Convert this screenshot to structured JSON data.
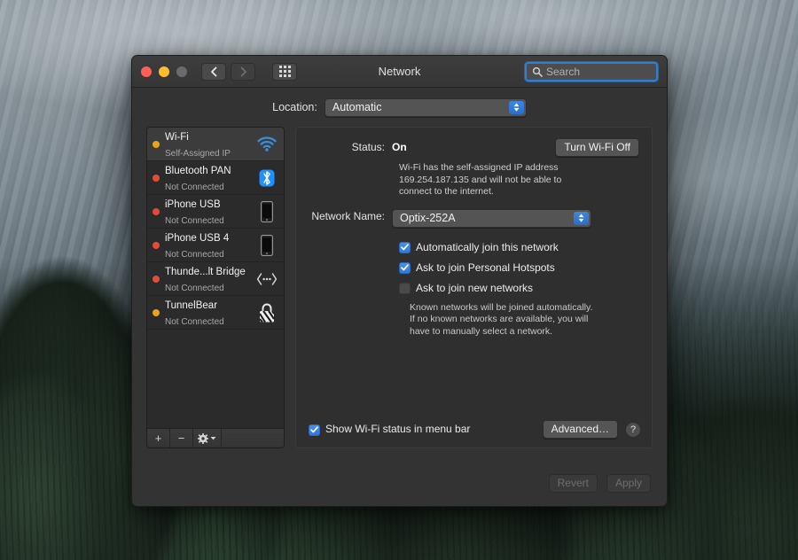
{
  "window": {
    "title": "Network",
    "traffic_lights": [
      "close",
      "minimize",
      "zoom"
    ],
    "nav": {
      "back": "back-chevron",
      "forward": "forward-chevron",
      "grid": "show-all-grid"
    },
    "search": {
      "placeholder": "Search",
      "value": "",
      "icon": "search-icon"
    }
  },
  "location": {
    "label": "Location:",
    "value": "Automatic"
  },
  "sidebar": {
    "services": [
      {
        "name": "Wi-Fi",
        "status": "Self-Assigned IP",
        "dot": "amber",
        "icon": "wifi-icon",
        "selected": true
      },
      {
        "name": "Bluetooth PAN",
        "status": "Not Connected",
        "dot": "red",
        "icon": "bluetooth-icon",
        "selected": false
      },
      {
        "name": "iPhone USB",
        "status": "Not Connected",
        "dot": "red",
        "icon": "iphone-icon",
        "selected": false
      },
      {
        "name": "iPhone USB 4",
        "status": "Not Connected",
        "dot": "red",
        "icon": "iphone-icon",
        "selected": false
      },
      {
        "name": "Thunde...lt Bridge",
        "status": "Not Connected",
        "dot": "red",
        "icon": "thunderbolt-icon",
        "selected": false
      },
      {
        "name": "TunnelBear",
        "status": "Not Connected",
        "dot": "amber",
        "icon": "lock-icon",
        "selected": false
      }
    ],
    "toolbar": {
      "add": "+",
      "remove": "−",
      "actions": "gear-icon"
    }
  },
  "detail": {
    "status_label": "Status:",
    "status_value": "On",
    "turn_off_button": "Turn Wi-Fi Off",
    "status_description": "Wi-Fi has the self-assigned IP address 169.254.187.135 and will not be able to connect to the internet.",
    "network_name_label": "Network Name:",
    "network_name_value": "Optix-252A",
    "checkboxes": [
      {
        "label": "Automatically join this network",
        "checked": true
      },
      {
        "label": "Ask to join Personal Hotspots",
        "checked": true
      },
      {
        "label": "Ask to join new networks",
        "checked": false
      }
    ],
    "known_networks_note": "Known networks will be joined automatically. If no known networks are available, you will have to manually select a network.",
    "menubar_checkbox": {
      "label": "Show Wi-Fi status in menu bar",
      "checked": true
    },
    "advanced_button": "Advanced…",
    "help_button": "?"
  },
  "footer": {
    "revert_button": "Revert",
    "apply_button": "Apply",
    "revert_enabled": false,
    "apply_enabled": false
  },
  "colors": {
    "accent_blue": "#2f7fd8",
    "status_amber": "#e8a317",
    "status_red": "#e04b3a",
    "wifi_icon_blue": "#3d8ddb",
    "bluetooth_blue": "#1e90ff",
    "window_bg": "#333333",
    "sidebar_bg": "#2b2b2b",
    "detail_bg": "#2f2f2f"
  }
}
